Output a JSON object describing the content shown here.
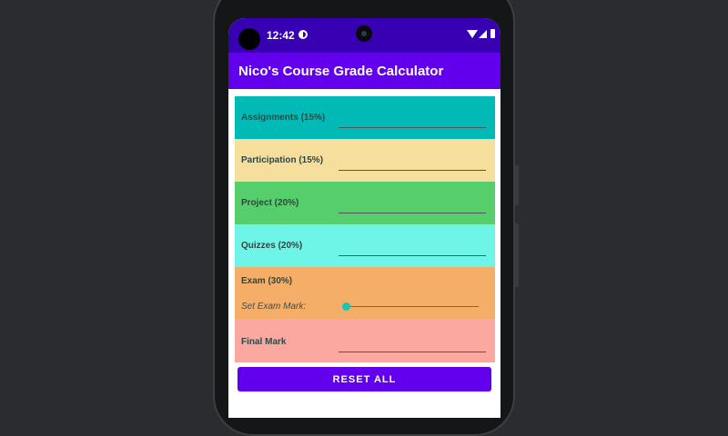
{
  "status_bar": {
    "time": "12:42"
  },
  "app_bar": {
    "title": "Nico's Course Grade Calculator"
  },
  "rows": [
    {
      "label": "Assignments (15%)",
      "value": "",
      "color": "#01bab6"
    },
    {
      "label": "Participation (15%)",
      "value": "",
      "color": "#f6de9c"
    },
    {
      "label": "Project (20%)",
      "value": "",
      "color": "#55ce6b"
    },
    {
      "label": "Quizzes (20%)",
      "value": "",
      "color": "#6ef5e8"
    }
  ],
  "exam": {
    "label": "Exam (30%)",
    "slider_label": "Set Exam Mark:",
    "slider_value": 0,
    "color": "#f4ae67"
  },
  "final": {
    "label": "Final Mark",
    "value": "",
    "color": "#fba8a1"
  },
  "reset_button": {
    "label": "RESET ALL"
  },
  "colors": {
    "status_bar": "#3700b3",
    "app_bar": "#6200ee",
    "accent": "#16c6b8"
  }
}
